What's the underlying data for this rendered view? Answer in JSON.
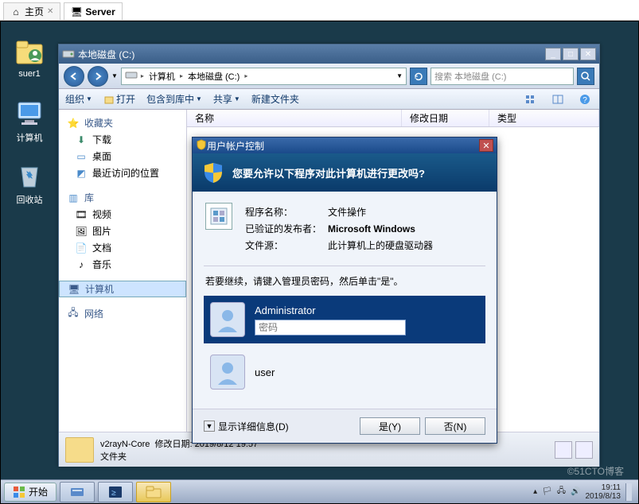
{
  "host": {
    "tabs": [
      {
        "label": "主页",
        "icon": "home"
      },
      {
        "label": "Server",
        "icon": "monitor"
      }
    ]
  },
  "desktop": {
    "icons": [
      {
        "label": "suer1"
      },
      {
        "label": "计算机"
      },
      {
        "label": "回收站"
      }
    ]
  },
  "explorer": {
    "title": "本地磁盘 (C:)",
    "breadcrumb": {
      "root": "计算机",
      "seg1": "本地磁盘 (C:)"
    },
    "search_placeholder": "搜索 本地磁盘 (C:)",
    "toolbar": {
      "organize": "组织",
      "open": "打开",
      "include": "包含到库中",
      "share": "共享",
      "newfolder": "新建文件夹"
    },
    "tree": {
      "favorites": "收藏夹",
      "downloads": "下载",
      "desktop": "桌面",
      "recent": "最近访问的位置",
      "libraries": "库",
      "videos": "视频",
      "pictures": "图片",
      "documents": "文档",
      "music": "音乐",
      "computer": "计算机",
      "network": "网络"
    },
    "columns": {
      "name": "名称",
      "modified": "修改日期",
      "type": "类型"
    },
    "status": {
      "folder": "v2rayN-Core",
      "label": "修改日期:",
      "date": "2019/8/12 19:57",
      "kind": "文件夹"
    }
  },
  "uac": {
    "title": "用户帐户控制",
    "question": "您要允许以下程序对此计算机进行更改吗?",
    "labels": {
      "program": "程序名称：",
      "publisher": "已验证的发布者：",
      "origin": "文件源："
    },
    "values": {
      "program": "文件操作",
      "publisher": "Microsoft Windows",
      "origin": "此计算机上的硬盘驱动器"
    },
    "prompt": "若要继续，请键入管理员密码，然后单击\"是\"。",
    "users": {
      "admin": "Administrator",
      "user": "user"
    },
    "password_placeholder": "密码",
    "details": "显示详细信息(D)",
    "yes": "是(Y)",
    "no": "否(N)"
  },
  "taskbar": {
    "start": "开始",
    "time": "19:11",
    "date": "2019/8/13"
  },
  "watermark": "©51CTO博客"
}
